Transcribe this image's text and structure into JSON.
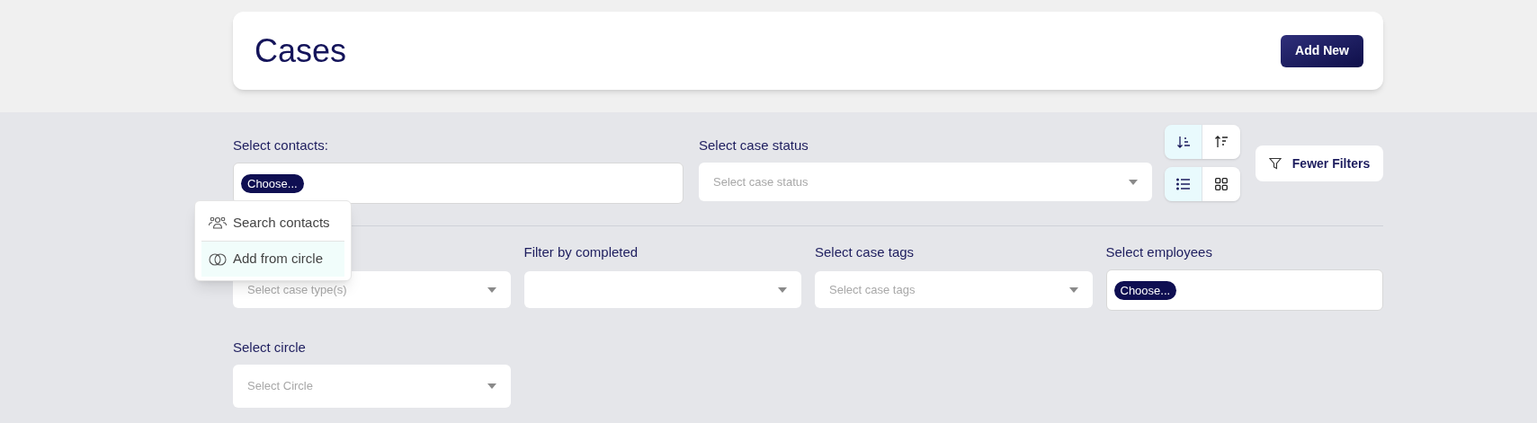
{
  "header": {
    "title": "Cases",
    "add_button": "Add New"
  },
  "contacts": {
    "label": "Select contacts:",
    "chip": "Choose..."
  },
  "case_status": {
    "label": "Select case status",
    "placeholder": "Select case status"
  },
  "sort_buttons": [
    {
      "kind": "sort-desc",
      "selected": true
    },
    {
      "kind": "sort-asc",
      "selected": false
    }
  ],
  "view_buttons": [
    {
      "kind": "list",
      "selected": true
    },
    {
      "kind": "grid",
      "selected": false
    }
  ],
  "filters_button": "Fewer Filters",
  "contacts_menu": [
    {
      "kind": "search",
      "label": "Search contacts",
      "selected": false
    },
    {
      "kind": "circle",
      "label": "Add from circle",
      "selected": true
    }
  ],
  "filters": [
    {
      "kind": "select",
      "placeholder": "Select case type(s)"
    },
    {
      "kind": "select",
      "label": "Filter by completed"
    },
    {
      "kind": "select",
      "label": "Select case tags",
      "placeholder": "Select case tags"
    },
    {
      "kind": "chips",
      "label": "Select employees",
      "chip": "Choose..."
    }
  ],
  "circle": {
    "label": "Select circle",
    "placeholder": "Select Circle"
  }
}
